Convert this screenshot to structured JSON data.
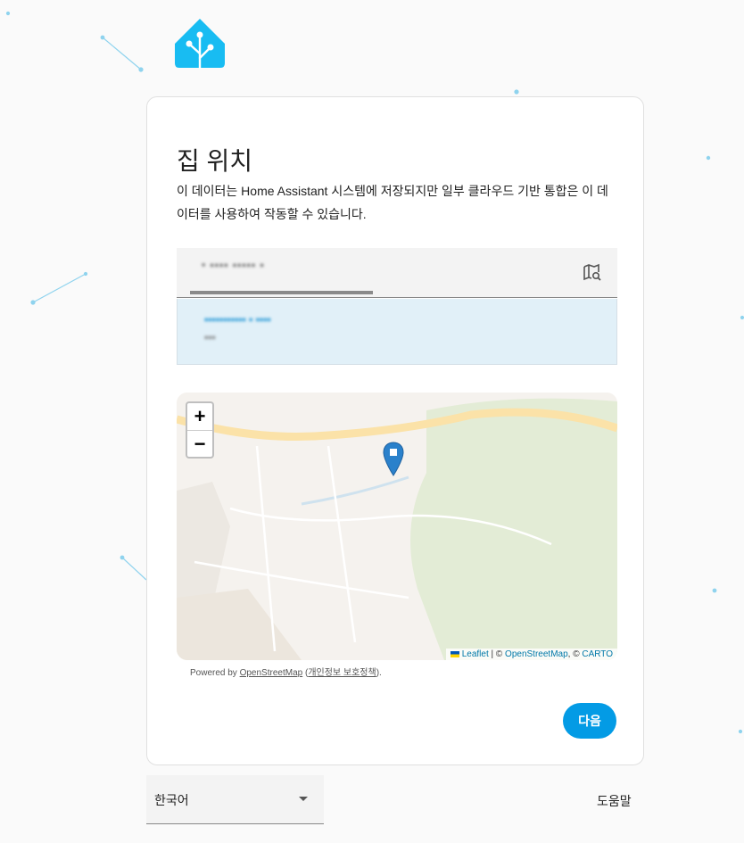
{
  "colors": {
    "accent": "#039be5",
    "logo": "#18bcf2",
    "result_bg": "#e1f0f8"
  },
  "icons": {
    "logo": "home-assistant-logo-icon",
    "map_search": "map-search-icon",
    "marker": "map-marker-icon",
    "dropdown": "caret-down-icon"
  },
  "onboarding": {
    "title": "집 위치",
    "description": "이 데이터는 Home Assistant 시스템에 저장되지만 일부 클라우드 기반 통합은 이 데이터를 사용하여 작동할 수 있습니다.",
    "search": {
      "value": "• ▪▪▪▪ ▪▪▪▪▪ ▪"
    },
    "result": {
      "line1": "▪▪▪▪▪▪▪▪▪▪▪ ▪ ▪▪▪▪",
      "line2": "▪▪▪"
    },
    "map": {
      "zoom_in": "+",
      "zoom_out": "−",
      "attribution": {
        "leaflet": "Leaflet",
        "sep1": " | © ",
        "osm": "OpenStreetMap",
        "sep2": ", © ",
        "carto": "CARTO"
      }
    },
    "powered": {
      "prefix": "Powered by ",
      "osm_link": "OpenStreetMap",
      "open_paren": " (",
      "privacy_link": "개인정보 보호정책",
      "close": ")."
    },
    "next_button": "다음"
  },
  "footer": {
    "language": "한국어",
    "help": "도움말"
  }
}
